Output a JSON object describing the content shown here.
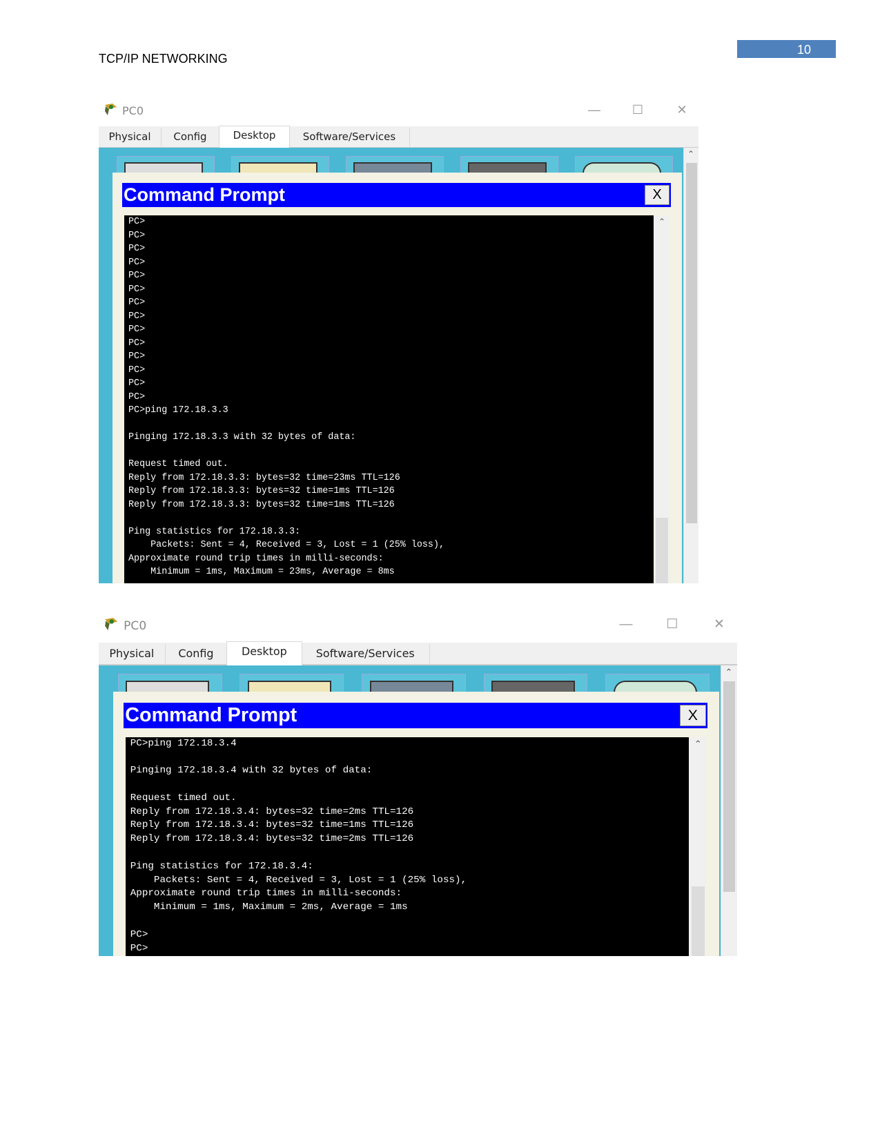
{
  "header": {
    "title": "TCP/IP NETWORKING",
    "page_number": "10"
  },
  "windows": [
    {
      "title": "PC0",
      "tabs": [
        "Physical",
        "Config",
        "Desktop",
        "Software/Services"
      ],
      "active_tab": "Desktop",
      "cmd_title": "Command Prompt",
      "close_label": "X",
      "lines": [
        "PC>",
        "PC>",
        "PC>",
        "PC>",
        "PC>",
        "PC>",
        "PC>",
        "PC>",
        "PC>",
        "PC>",
        "PC>",
        "PC>",
        "PC>",
        "PC>",
        "PC>ping 172.18.3.3",
        "",
        "Pinging 172.18.3.3 with 32 bytes of data:",
        "",
        "Request timed out.",
        "Reply from 172.18.3.3: bytes=32 time=23ms TTL=126",
        "Reply from 172.18.3.3: bytes=32 time=1ms TTL=126",
        "Reply from 172.18.3.3: bytes=32 time=1ms TTL=126",
        "",
        "Ping statistics for 172.18.3.3:",
        "    Packets: Sent = 4, Received = 3, Lost = 1 (25% loss),",
        "Approximate round trip times in milli-seconds:",
        "    Minimum = 1ms, Maximum = 23ms, Average = 8ms"
      ]
    },
    {
      "title": "PC0",
      "tabs": [
        "Physical",
        "Config",
        "Desktop",
        "Software/Services"
      ],
      "active_tab": "Desktop",
      "cmd_title": "Command Prompt",
      "close_label": "X",
      "lines": [
        "PC>ping 172.18.3.4",
        "",
        "Pinging 172.18.3.4 with 32 bytes of data:",
        "",
        "Request timed out.",
        "Reply from 172.18.3.4: bytes=32 time=2ms TTL=126",
        "Reply from 172.18.3.4: bytes=32 time=1ms TTL=126",
        "Reply from 172.18.3.4: bytes=32 time=2ms TTL=126",
        "",
        "Ping statistics for 172.18.3.4:",
        "    Packets: Sent = 4, Received = 3, Lost = 1 (25% loss),",
        "Approximate round trip times in milli-seconds:",
        "    Minimum = 1ms, Maximum = 2ms, Average = 1ms",
        "",
        "PC>",
        "PC>"
      ]
    }
  ],
  "colors": {
    "cmd_titlebar": "#0000ff",
    "desktop_bg": "#4ab8d3",
    "page_number_bg": "#4f81bd"
  }
}
